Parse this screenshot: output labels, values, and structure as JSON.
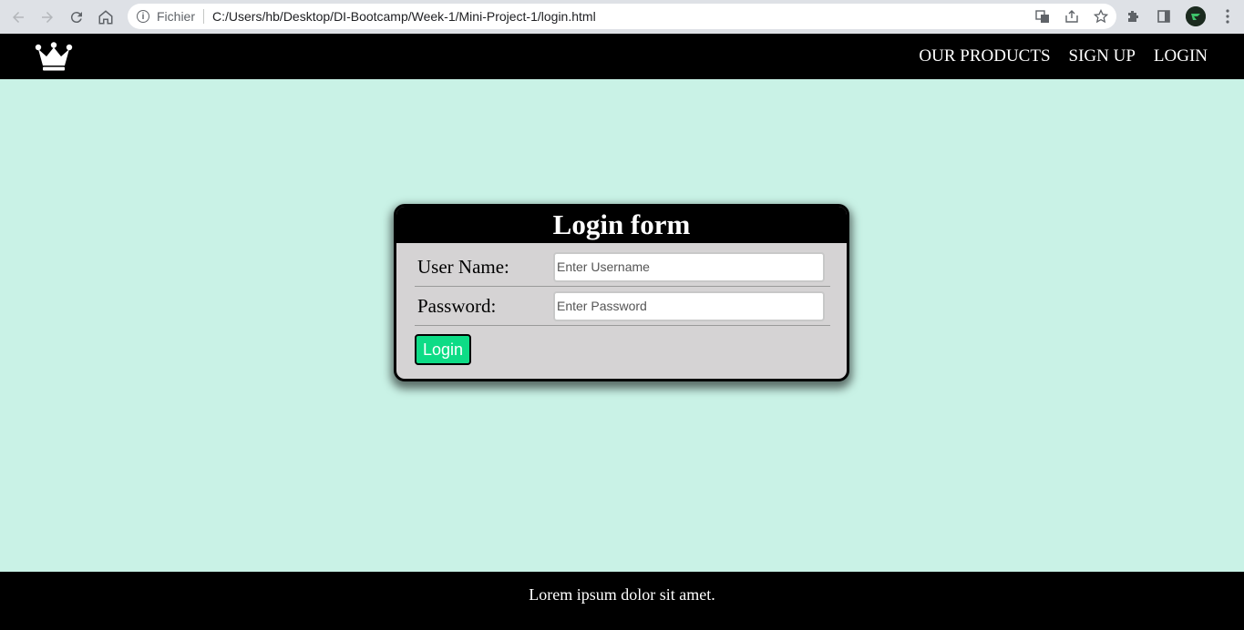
{
  "browser": {
    "scheme_label": "Fichier",
    "url": "C:/Users/hb/Desktop/DI-Bootcamp/Week-1/Mini-Project-1/login.html",
    "icons": [
      "back-icon",
      "forward-icon",
      "reload-icon",
      "home-icon",
      "info-icon",
      "translate-icon",
      "share-icon",
      "star-icon",
      "extensions-icon",
      "sidepanel-icon",
      "profile-avatar",
      "menu-icon"
    ]
  },
  "nav": {
    "logo_icon": "crown-icon",
    "links": [
      "OUR PRODUCTS",
      "SIGN UP",
      "LOGIN"
    ]
  },
  "login_form": {
    "title": "Login form",
    "username_label": "User Name:",
    "username_placeholder": "Enter Username",
    "password_label": "Password:",
    "password_placeholder": "Enter Password",
    "submit_label": "Login"
  },
  "footer": {
    "text": "Lorem ipsum dolor sit amet."
  },
  "colors": {
    "page_background": "#c9f2e6",
    "nav_background": "#000000",
    "card_background": "#d5d3d4",
    "button_background": "#0ddc86"
  }
}
